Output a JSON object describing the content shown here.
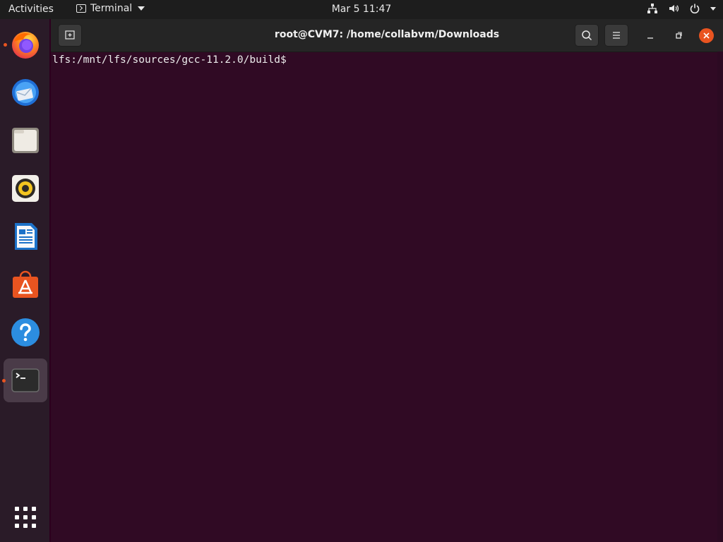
{
  "topbar": {
    "activities": "Activities",
    "app_name": "Terminal",
    "clock": "Mar 5  11:47",
    "tray_icons": [
      "network-icon",
      "volume-icon",
      "power-icon"
    ]
  },
  "dock": {
    "items": [
      {
        "name": "firefox",
        "running": true
      },
      {
        "name": "thunderbird",
        "running": false
      },
      {
        "name": "files",
        "running": false
      },
      {
        "name": "rhythmbox",
        "running": false
      },
      {
        "name": "libreoffice-writer",
        "running": false
      },
      {
        "name": "ubuntu-software",
        "running": false
      },
      {
        "name": "help",
        "running": false
      },
      {
        "name": "terminal",
        "running": true,
        "active": true
      }
    ],
    "show_apps_icon": "app-grid-icon"
  },
  "window": {
    "title": "root@CVM7: /home/collabvm/Downloads",
    "prompt_line": "lfs:/mnt/lfs/sources/gcc-11.2.0/build$ "
  },
  "colors": {
    "terminal_bg": "#300a24",
    "topbar_bg": "#1d1d1d",
    "titlebar_bg": "#252525",
    "accent": "#e95420"
  }
}
